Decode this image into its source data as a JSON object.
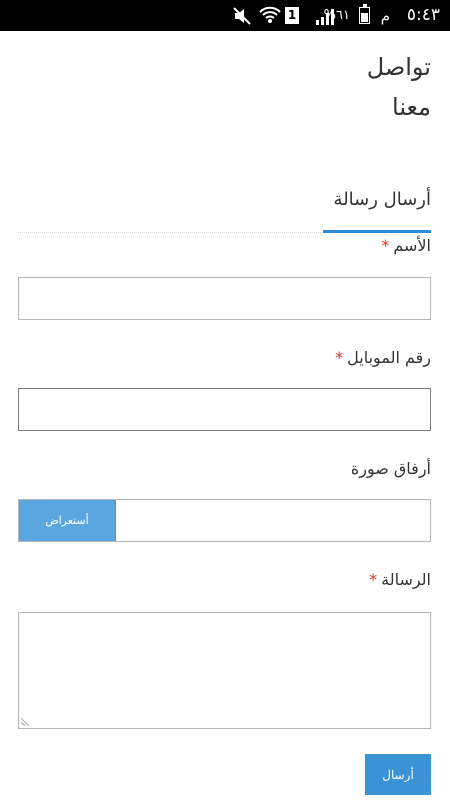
{
  "status_bar": {
    "time": "٥:٤٣",
    "ampm": "م",
    "battery_percent": "%٦١",
    "sim_slot": "1"
  },
  "page": {
    "title_line1": "تواصل",
    "title_line2": "معنا"
  },
  "tabs": [
    {
      "label": "أرسال رسالة",
      "active": true
    }
  ],
  "form": {
    "name_label": "الأسم",
    "mobile_label": "رقم الموبايل",
    "attach_label": "أرفاق صورة",
    "browse_label": "أستعراض",
    "message_label": "الرسالة",
    "required_mark": "*",
    "submit_label": "أرسال"
  },
  "colors": {
    "accent": "#2b8ad8",
    "button": "#3b93d6",
    "required": "#d9302b"
  }
}
